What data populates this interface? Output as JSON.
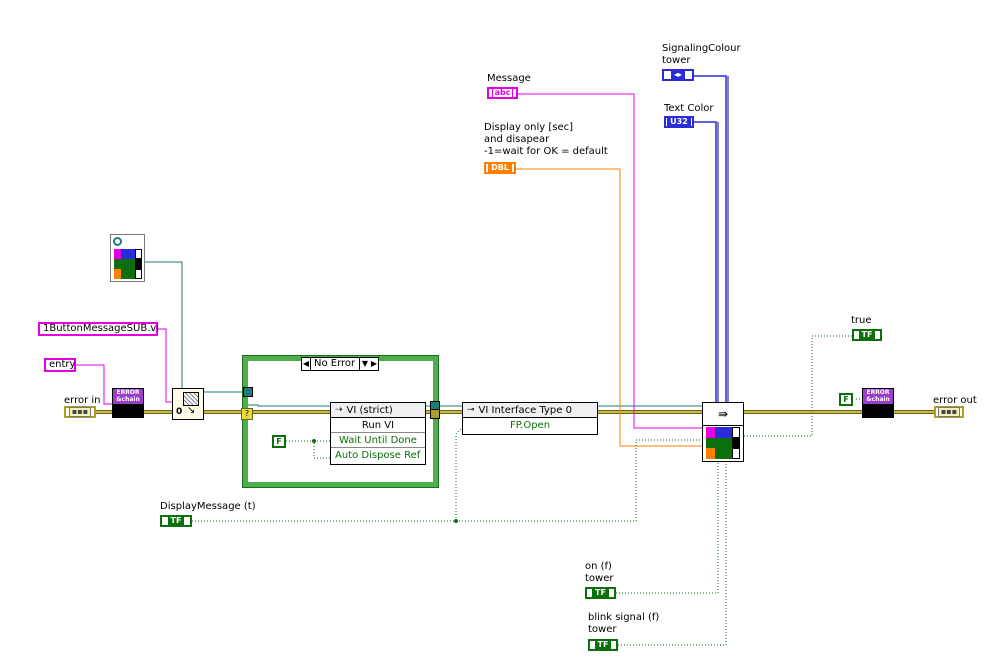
{
  "labels": {
    "message": "Message",
    "display_only": "Display only [sec]\nand disapear\n-1=wait for OK = default",
    "signaling_colour_tower": "SignalingColour\ntower",
    "text_color": "Text Color",
    "true": "true",
    "error_in": "error in",
    "error_out": "error out",
    "display_message": "DisplayMessage (t)",
    "on_tower": "on (f)\ntower",
    "blink_signal_tower": "blink signal (f)\ntower"
  },
  "constants": {
    "vi_path": "1ButtonMessageSUB.vi",
    "entry": "entry",
    "f_const_1": "F",
    "f_const_2": "F"
  },
  "case_structure": {
    "selector": "No Error"
  },
  "run_vi_node": {
    "header": "VI (strict)",
    "method": "Run VI",
    "param_1": "Wait Until Done",
    "param_2": "Auto Dispose Ref"
  },
  "property_node": {
    "header": "VI Interface Type 0",
    "property": "FP.Open"
  },
  "terminal_types": {
    "message": "abc",
    "display_only": "DBL",
    "signaling_colour": "◂▸",
    "text_color": "U32",
    "true": "TF",
    "display_message": "TF",
    "on_tower": "TF",
    "blink_signal": "TF",
    "error": "▪▪▪",
    "error_node_caption": "ERROR\n&chain"
  },
  "colors": {
    "boolean": "#0b6f0b",
    "string": "#e400e4",
    "dbl": "#ff7f00",
    "u32": "#2b2bd8",
    "error_cluster": "#a8a028",
    "refnum": "#1f7a7a",
    "case_border": "#4caf4c"
  }
}
